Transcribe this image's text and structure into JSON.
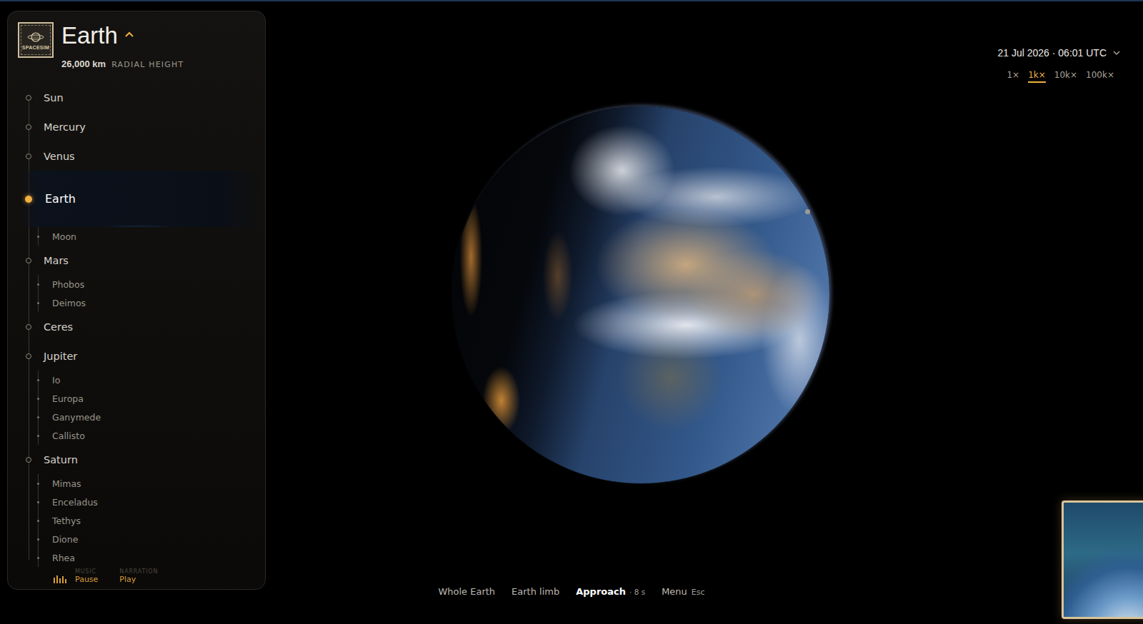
{
  "header": {
    "logo": "SPACESIM",
    "title": "Earth",
    "height": {
      "value": "26,000 km",
      "label": "RADIAL HEIGHT"
    }
  },
  "bodies": [
    {
      "name": "Sun",
      "kind": "planet",
      "selected": false
    },
    {
      "name": "Mercury",
      "kind": "planet",
      "selected": false
    },
    {
      "name": "Venus",
      "kind": "planet",
      "selected": false
    },
    {
      "name": "Earth",
      "kind": "planet",
      "selected": true
    },
    {
      "name": "Moon",
      "kind": "moon",
      "selected": false
    },
    {
      "name": "Mars",
      "kind": "planet",
      "selected": false
    },
    {
      "name": "Phobos",
      "kind": "moon",
      "selected": false
    },
    {
      "name": "Deimos",
      "kind": "moon",
      "selected": false
    },
    {
      "name": "Ceres",
      "kind": "planet",
      "selected": false
    },
    {
      "name": "Jupiter",
      "kind": "planet",
      "selected": false
    },
    {
      "name": "Io",
      "kind": "moon",
      "selected": false
    },
    {
      "name": "Europa",
      "kind": "moon",
      "selected": false
    },
    {
      "name": "Ganymede",
      "kind": "moon",
      "selected": false
    },
    {
      "name": "Callisto",
      "kind": "moon",
      "selected": false
    },
    {
      "name": "Saturn",
      "kind": "planet",
      "selected": false
    },
    {
      "name": "Mimas",
      "kind": "moon",
      "selected": false
    },
    {
      "name": "Enceladus",
      "kind": "moon",
      "selected": false
    },
    {
      "name": "Tethys",
      "kind": "moon",
      "selected": false
    },
    {
      "name": "Dione",
      "kind": "moon",
      "selected": false
    },
    {
      "name": "Rhea",
      "kind": "moon",
      "selected": false
    }
  ],
  "audio": [
    {
      "label": "MUSIC",
      "action": "Pause"
    },
    {
      "label": "NARRATION",
      "action": "Play"
    }
  ],
  "clock": {
    "datetime": "21 Jul 2026 · 06:01 UTC"
  },
  "speeds": [
    {
      "label": "1×",
      "selected": false
    },
    {
      "label": "1k×",
      "selected": true
    },
    {
      "label": "10k×",
      "selected": false
    },
    {
      "label": "100k×",
      "selected": false
    }
  ],
  "views": [
    {
      "label": "Whole Earth",
      "selected": false
    },
    {
      "label": "Earth limb",
      "selected": false
    },
    {
      "label": "Approach",
      "selected": true,
      "detail": "· 8 s"
    }
  ],
  "menu": {
    "label": "Menu",
    "key": "Esc"
  }
}
